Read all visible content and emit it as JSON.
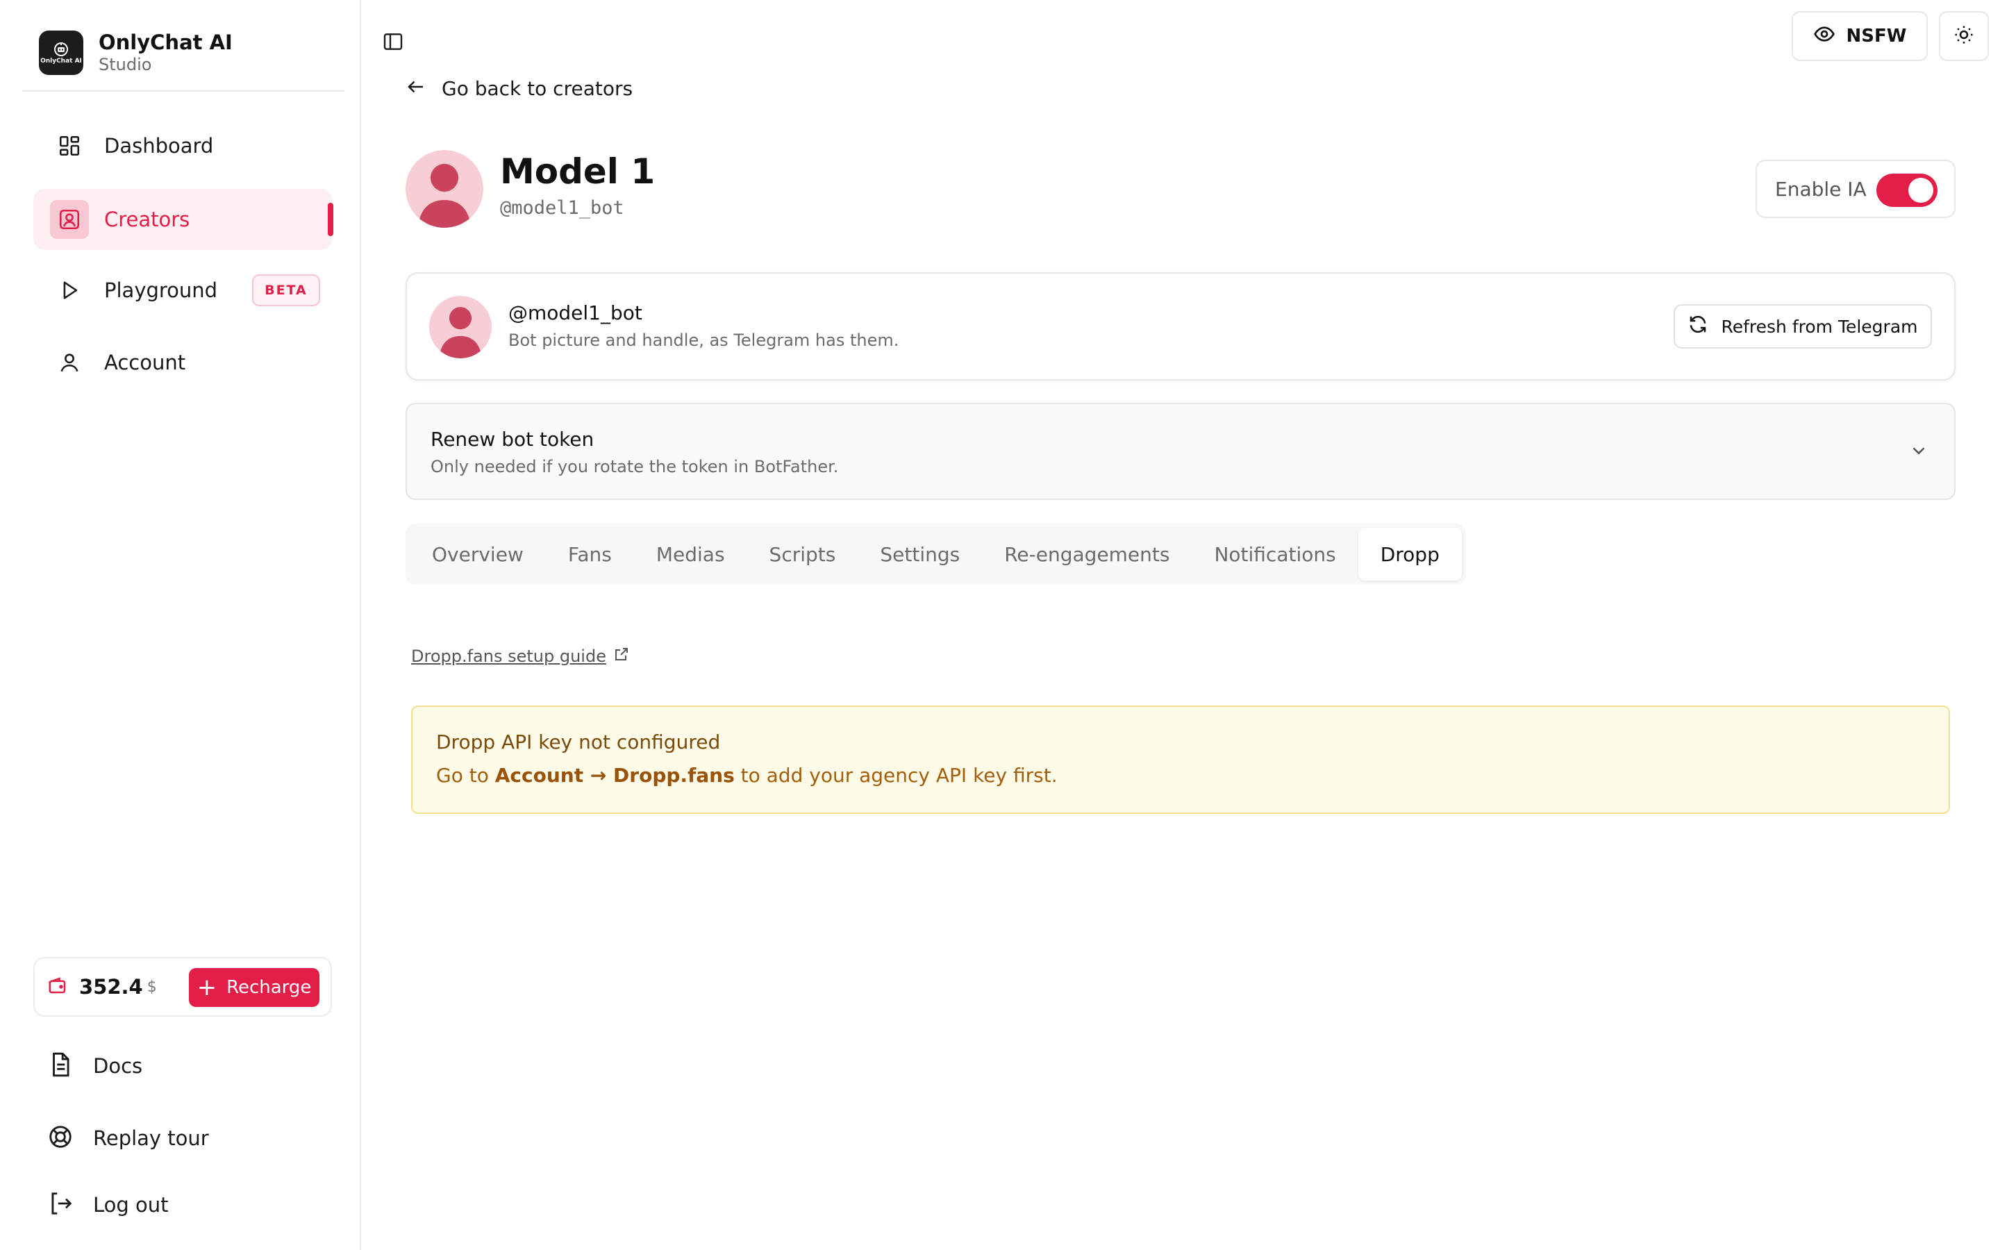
{
  "brand": {
    "title": "OnlyChat AI",
    "subtitle": "Studio",
    "logo_text": "OnlyChat AI"
  },
  "sidebar": {
    "items": [
      {
        "label": "Dashboard",
        "icon": "dashboard-icon"
      },
      {
        "label": "Creators",
        "icon": "creators-icon",
        "active": true
      },
      {
        "label": "Playground",
        "icon": "play-icon",
        "badge": "BETA"
      },
      {
        "label": "Account",
        "icon": "user-icon"
      }
    ],
    "balance": {
      "amount": "352.4",
      "currency": "$",
      "recharge_label": "Recharge"
    },
    "bottom_items": [
      {
        "label": "Docs",
        "icon": "document-icon"
      },
      {
        "label": "Replay tour",
        "icon": "lifebuoy-icon"
      },
      {
        "label": "Log out",
        "icon": "logout-icon"
      }
    ]
  },
  "header": {
    "nsfw_label": "NSFW"
  },
  "page": {
    "back_label": "Go back to creators",
    "model_name": "Model 1",
    "model_handle": "@model1_bot",
    "enable_label": "Enable IA",
    "enable_on": true
  },
  "bot_card": {
    "handle": "@model1_bot",
    "description": "Bot picture and handle, as Telegram has them.",
    "refresh_label": "Refresh from Telegram"
  },
  "renew_card": {
    "title": "Renew bot token",
    "description": "Only needed if you rotate the token in BotFather."
  },
  "tabs": [
    {
      "label": "Overview"
    },
    {
      "label": "Fans"
    },
    {
      "label": "Medias"
    },
    {
      "label": "Scripts"
    },
    {
      "label": "Settings"
    },
    {
      "label": "Re-engagements"
    },
    {
      "label": "Notifications"
    },
    {
      "label": "Dropp",
      "active": true
    }
  ],
  "dropp": {
    "guide_label": "Dropp.fans setup guide",
    "warning_title": "Dropp API key not configured",
    "warning_prefix": "Go to ",
    "warning_link": "Account → Dropp.fans",
    "warning_suffix": " to add your agency API key first."
  },
  "colors": {
    "accent": "#e11d48",
    "accent_soft": "#fdeef1",
    "warning_bg": "#fefbe8",
    "warning_border": "#f2df90"
  }
}
